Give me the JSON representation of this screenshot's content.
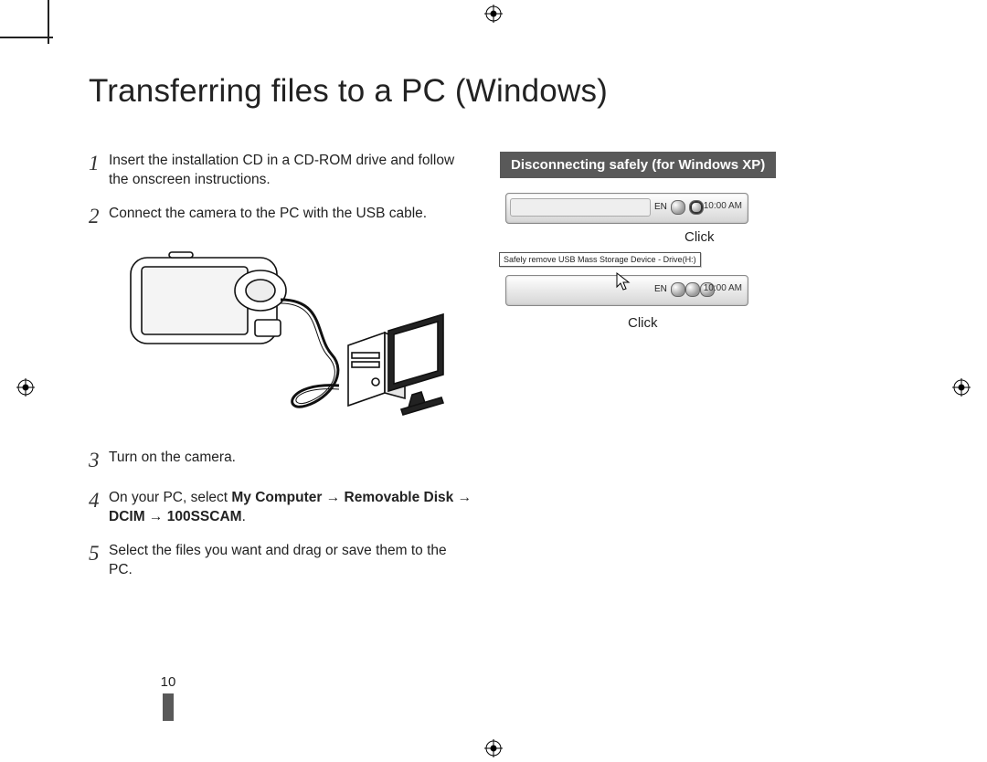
{
  "page": {
    "title": "Transferring files to a PC (Windows)",
    "number": "10"
  },
  "steps": [
    {
      "n": "1",
      "text": "Insert the installation CD in a CD-ROM drive and follow the onscreen instructions."
    },
    {
      "n": "2",
      "text": "Connect the camera to the PC with the USB cable."
    },
    {
      "n": "3",
      "text": "Turn on the camera."
    },
    {
      "n": "4",
      "prefix": "On your PC, select ",
      "bold": "My Computer → Removable Disk → DCIM → 100SSCAM",
      "suffix": "."
    },
    {
      "n": "5",
      "text": "Select the files you want and drag or save them to the PC."
    }
  ],
  "sidebar": {
    "heading": "Disconnecting safely (for Windows XP)",
    "click1": "Click",
    "arrow": "▼",
    "tooltip": "Safely remove USB Mass Storage Device - Drive(H:)",
    "click2": "Click",
    "taskbar": {
      "lang": "EN",
      "time": "10:00 AM"
    }
  }
}
